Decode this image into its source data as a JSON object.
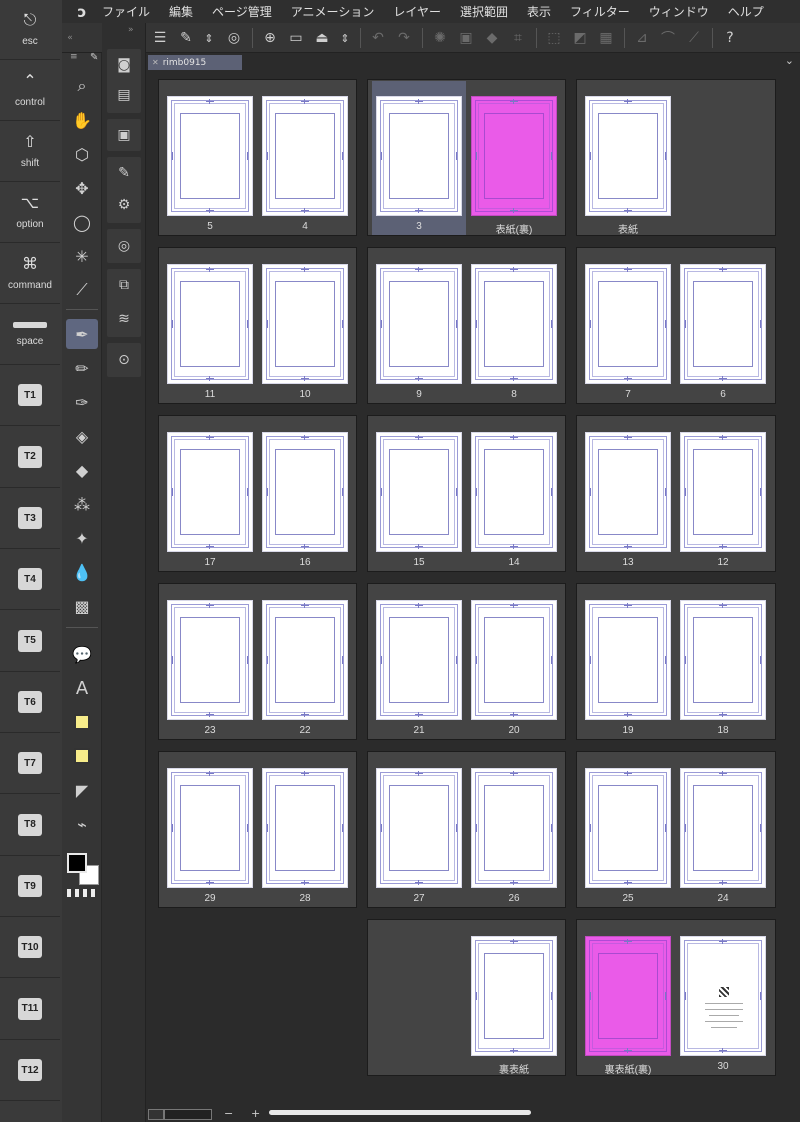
{
  "modifier_keys": [
    {
      "icon": "⎋",
      "label": "esc"
    },
    {
      "icon": "⌃",
      "label": "control"
    },
    {
      "icon": "⇧",
      "label": "shift"
    },
    {
      "icon": "⌥",
      "label": "option"
    },
    {
      "icon": "⌘",
      "label": "command"
    },
    {
      "icon": "",
      "label": "space"
    }
  ],
  "tool_keys": [
    "T1",
    "T2",
    "T3",
    "T4",
    "T5",
    "T6",
    "T7",
    "T8",
    "T9",
    "T10",
    "T11",
    "T12"
  ],
  "menu": [
    "ファイル",
    "編集",
    "ページ管理",
    "アニメーション",
    "レイヤー",
    "選択範囲",
    "表示",
    "フィルター",
    "ウィンドウ",
    "ヘルプ"
  ],
  "tab": {
    "title": "rimb0915"
  },
  "pages": {
    "p5": "5",
    "p4": "4",
    "p3": "3",
    "p_cover_back": "表紙(裏)",
    "p_cover": "表紙",
    "p11": "11",
    "p10": "10",
    "p9": "9",
    "p8": "8",
    "p7": "7",
    "p6": "6",
    "p17": "17",
    "p16": "16",
    "p15": "15",
    "p14": "14",
    "p13": "13",
    "p12": "12",
    "p23": "23",
    "p22": "22",
    "p21": "21",
    "p20": "20",
    "p19": "19",
    "p18": "18",
    "p29": "29",
    "p28": "28",
    "p27": "27",
    "p26": "26",
    "p25": "25",
    "p24": "24",
    "p_backcover": "裏表紙",
    "p_backcover_back": "裏表紙(裏)",
    "p30": "30"
  },
  "colors": {
    "accent": "#5f6780",
    "pink_page": "#ea5be8",
    "foreground": "#000000",
    "background": "#ffffff"
  },
  "zoom": {
    "minus": "−",
    "plus": "+"
  }
}
